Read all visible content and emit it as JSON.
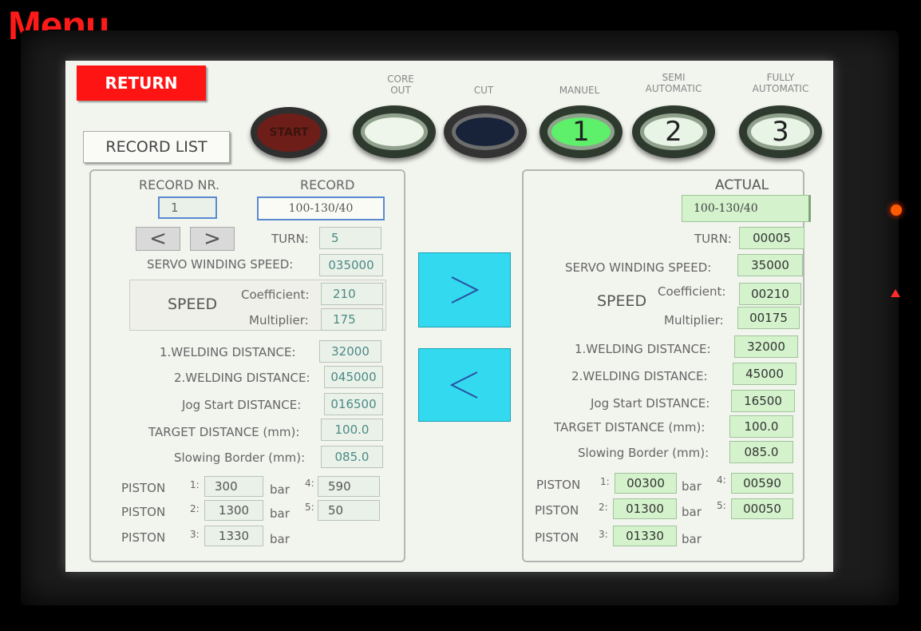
{
  "overlay_title": "Menu",
  "header": {
    "return_label": "RETURN",
    "record_list_label": "RECORD LIST",
    "start_label": "START",
    "modes": [
      {
        "caption": "CORE\nOUT",
        "label": ""
      },
      {
        "caption": "CUT",
        "label": ""
      },
      {
        "caption": "MANUEL",
        "label": "1"
      },
      {
        "caption": "SEMI\nAUTOMATIC",
        "label": "2"
      },
      {
        "caption": "FULLY\nAUTOMATIC",
        "label": "3"
      }
    ]
  },
  "record_panel": {
    "record_nr_label": "RECORD NR.",
    "record_label": "RECORD",
    "record_nr": "1",
    "record": "100-130/40",
    "prev_icon": "chevron-left-icon",
    "next_icon": "chevron-right-icon",
    "turn_label": "TURN:",
    "turn": "5",
    "servo_label": "SERVO WINDING SPEED:",
    "servo": "035000",
    "speed_label": "SPEED",
    "coefficient_label": "Coefficient:",
    "coefficient": "210",
    "multiplier_label": "Multiplier:",
    "multiplier": "175",
    "weld1_label": "1.WELDING DISTANCE:",
    "weld1": "32000",
    "weld2_label": "2.WELDING DISTANCE:",
    "weld2": "045000",
    "jog_label": "Jog Start DISTANCE:",
    "jog": "016500",
    "target_label": "TARGET DISTANCE (mm):",
    "target": "100.0",
    "slowing_label": "Slowing Border (mm):",
    "slowing": "085.0",
    "piston_label": "PISTON",
    "bar_label": "bar",
    "pistons": [
      {
        "n": "1:",
        "v": "300"
      },
      {
        "n": "2:",
        "v": "1300"
      },
      {
        "n": "3:",
        "v": "1330"
      },
      {
        "n": "4:",
        "v": "590"
      },
      {
        "n": "5:",
        "v": "50"
      }
    ]
  },
  "transfer": {
    "right_icon": "chevron-right-icon",
    "left_icon": "chevron-left-icon"
  },
  "actual_panel": {
    "title": "ACTUAL",
    "record": "100-130/40",
    "turn_label": "TURN:",
    "turn": "00005",
    "servo_label": "SERVO WINDING SPEED:",
    "servo": "35000",
    "speed_label": "SPEED",
    "coefficient_label": "Coefficient:",
    "coefficient": "00210",
    "multiplier_label": "Multiplier:",
    "multiplier": "00175",
    "weld1_label": "1.WELDING DISTANCE:",
    "weld1": "32000",
    "weld2_label": "2.WELDING DISTANCE:",
    "weld2": "45000",
    "jog_label": "Jog Start DISTANCE:",
    "jog": "16500",
    "target_label": "TARGET DISTANCE (mm):",
    "target": "100.0",
    "slowing_label": "Slowing Border (mm):",
    "slowing": "085.0",
    "piston_label": "PISTON",
    "bar_label": "bar",
    "pistons": [
      {
        "n": "1:",
        "v": "00300"
      },
      {
        "n": "2:",
        "v": "01300"
      },
      {
        "n": "3:",
        "v": "01330"
      },
      {
        "n": "4:",
        "v": "00590"
      },
      {
        "n": "5:",
        "v": "00050"
      }
    ]
  },
  "colors": {
    "return": "#ff1414",
    "arrow_button": "#33d9ef",
    "manuel_active": "#5ef06a",
    "actual_field": "#d4f2cc"
  }
}
